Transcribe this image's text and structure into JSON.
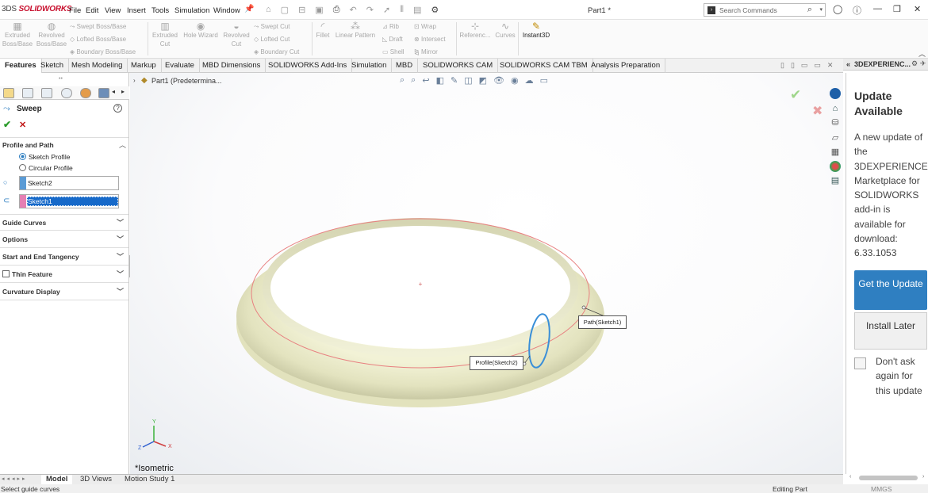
{
  "app": {
    "logo_brand": "3DS",
    "logo_text": "SOLIDWORKS",
    "document_title": "Part1 *"
  },
  "menu": [
    "File",
    "Edit",
    "View",
    "Insert",
    "Tools",
    "Simulation",
    "Window"
  ],
  "search": {
    "placeholder": "Search Commands"
  },
  "ribbon": {
    "extruded_boss": "Extruded Boss/Base",
    "revolved_boss": "Revolved Boss/Base",
    "swept_boss": "Swept Boss/Base",
    "lofted_boss": "Lofted Boss/Base",
    "boundary_boss": "Boundary Boss/Base",
    "extruded_cut": "Extruded Cut",
    "hole_wizard": "Hole Wizard",
    "revolved_cut": "Revolved Cut",
    "swept_cut": "Swept Cut",
    "lofted_cut": "Lofted Cut",
    "boundary_cut": "Boundary Cut",
    "fillet": "Fillet",
    "linear_pattern": "Linear Pattern",
    "rib": "Rib",
    "draft": "Draft",
    "shell": "Shell",
    "wrap": "Wrap",
    "intersect": "Intersect",
    "mirror": "Mirror",
    "reference": "Referenc...",
    "curves": "Curves",
    "instant3d": "Instant3D"
  },
  "tabs": [
    "Features",
    "Sketch",
    "Mesh Modeling",
    "Markup",
    "Evaluate",
    "MBD Dimensions",
    "SOLIDWORKS Add-Ins",
    "Simulation",
    "MBD",
    "SOLIDWORKS CAM",
    "SOLIDWORKS CAM TBM",
    "Analysis Preparation"
  ],
  "feature_manager": {
    "title": "Sweep",
    "profile_and_path": "Profile and Path",
    "sketch_profile": "Sketch Profile",
    "circular_profile": "Circular Profile",
    "profile_value": "Sketch2",
    "path_value": "Sketch1",
    "guide_curves": "Guide Curves",
    "options": "Options",
    "start_end_tangency": "Start and End Tangency",
    "thin_feature": "Thin Feature",
    "curvature_display": "Curvature Display"
  },
  "viewport": {
    "tree_root": "Part1  (Predetermina...",
    "path_label": "Path(Sketch1)",
    "profile_label": "Profile(Sketch2)",
    "view_name": "*Isometric",
    "axis_x": "X",
    "axis_y": "Y",
    "axis_z": "Z"
  },
  "bottom_tabs": [
    "Model",
    "3D Views",
    "Motion Study 1"
  ],
  "status": {
    "left": "Select guide curves",
    "units": "MMGS",
    "right": "Editing Part"
  },
  "task_pane": {
    "header": "3DEXPERIENC...",
    "title": "Update Available",
    "message": "A new update of the 3DEXPERIENCE Marketplace for SOLIDWORKS add-in is available for download: 6.33.1053",
    "get_update": "Get the Update",
    "install_later": "Install Later",
    "dont_ask": "Don't ask again for this update"
  },
  "colors": {
    "accent": "#2f7fc1",
    "brand": "#c8102e",
    "model": "#e6e6c2",
    "path_curve": "#e88080",
    "profile_circle": "#3a8fd8"
  }
}
